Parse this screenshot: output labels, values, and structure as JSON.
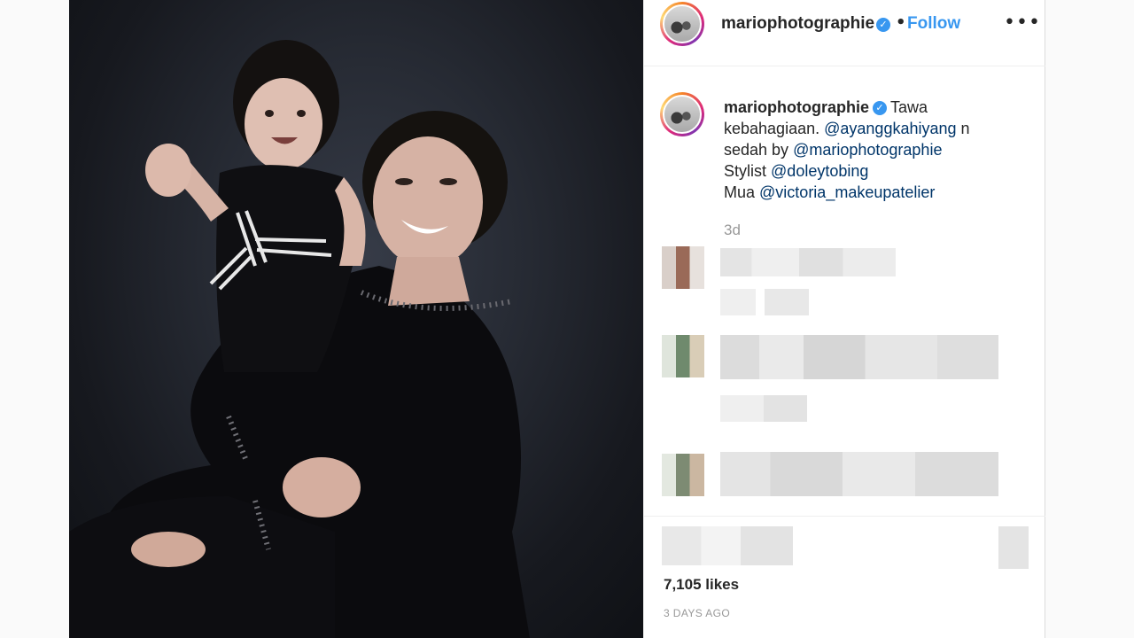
{
  "post": {
    "username": "mariophotographie",
    "separator": "•",
    "follow_label": "Follow",
    "more_label": "•••"
  },
  "caption": {
    "username": "mariophotographie",
    "line1_text": "Tawa",
    "line2_text": "kebahagiaan.",
    "mention1": "@ayanggkahiyang",
    "line2_tail": "n",
    "line3_text": "sedah by",
    "mention2": "@mariophotographie",
    "line4_text": "Stylist",
    "mention3": "@doleytobing",
    "line5_text": "Mua",
    "mention4": "@victoria_makeupatelier"
  },
  "post_age": "3d",
  "likes": "7,105 likes",
  "timestamp": "3 DAYS AGO",
  "icons": {
    "verified": "verified-check-icon",
    "more": "more-options-icon"
  },
  "colors": {
    "link": "#3897f0",
    "mention": "#003569",
    "muted": "#999999"
  }
}
